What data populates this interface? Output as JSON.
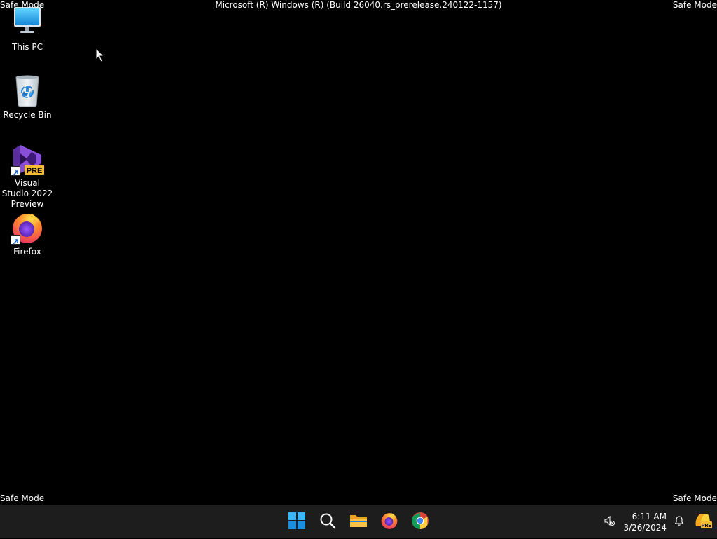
{
  "overlay": {
    "safe_mode_top_left": "Safe Mode",
    "safe_mode_top_right": "Safe Mode",
    "safe_mode_bottom_left": "Safe Mode",
    "safe_mode_bottom_right": "Safe Mode",
    "build_title": "Microsoft (R) Windows (R) (Build 26040.rs_prerelease.240122-1157)"
  },
  "desktop": {
    "icons": [
      {
        "label": "This PC",
        "icon": "monitor-icon"
      },
      {
        "label": "Recycle Bin",
        "icon": "recycle-bin-icon"
      },
      {
        "label": "Visual Studio 2022 Preview",
        "icon": "visual-studio-preview-icon",
        "shortcut": true,
        "badge": "PRE"
      },
      {
        "label": "Firefox",
        "icon": "firefox-icon",
        "shortcut": true
      }
    ]
  },
  "taskbar": {
    "pinned": [
      {
        "name": "start-button",
        "icon": "windows-logo-icon"
      },
      {
        "name": "search-button",
        "icon": "search-icon"
      },
      {
        "name": "file-explorer-button",
        "icon": "folder-icon"
      },
      {
        "name": "firefox-taskbar-button",
        "icon": "firefox-icon"
      },
      {
        "name": "chrome-taskbar-button",
        "icon": "chrome-icon"
      }
    ],
    "tray": {
      "time": "6:11 AM",
      "date": "3/26/2024",
      "volume_icon": "speaker-muted-icon",
      "notification_icon": "bell-icon",
      "copilot_icon": "copilot-preview-icon"
    }
  },
  "colors": {
    "desktop_bg": "#000000",
    "taskbar_bg": "#1d1d1d",
    "windows_blue": "#1ea1f1",
    "folder_yellow": "#f2b632",
    "vs_purple": "#7b3fc4",
    "firefox_orange": "#ff7139"
  }
}
